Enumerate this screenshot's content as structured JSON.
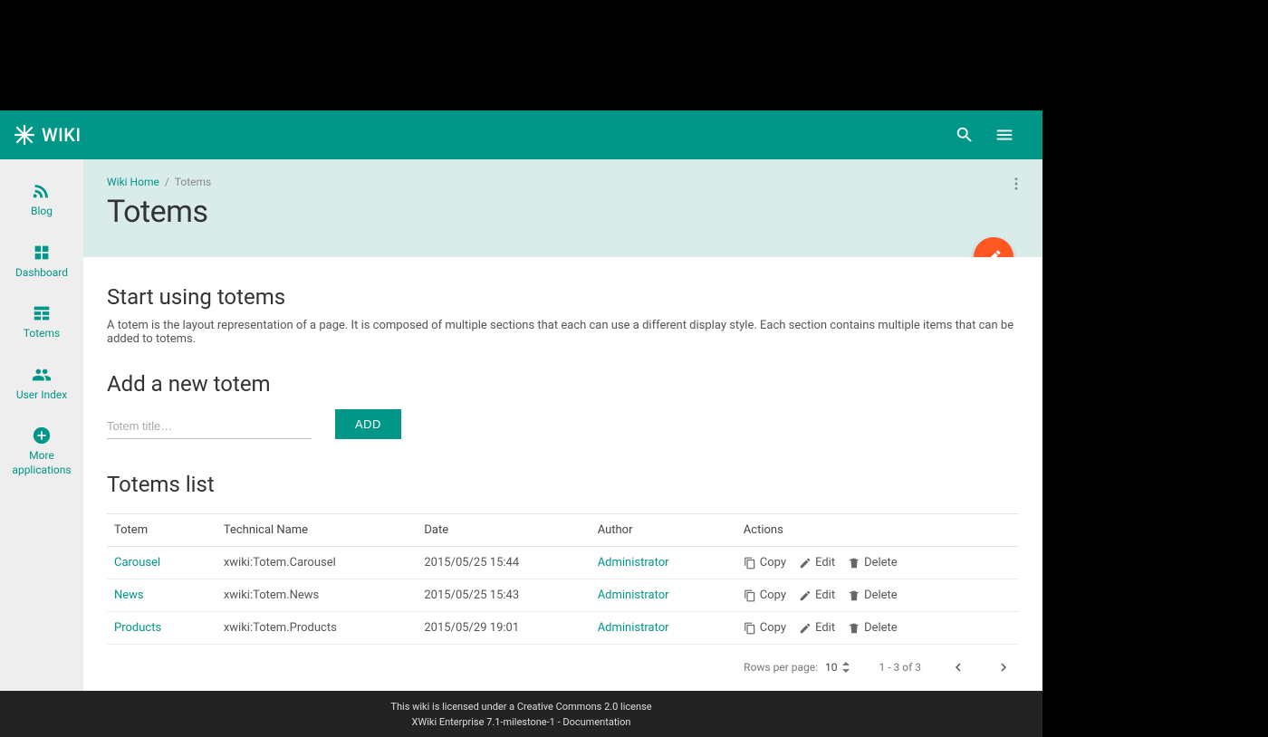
{
  "brand": {
    "text": "WIKI"
  },
  "breadcrumb": {
    "home": "Wiki Home",
    "current": "Totems"
  },
  "page": {
    "title": "Totems"
  },
  "intro": {
    "heading": "Start using totems",
    "body": "A totem is the layout representation of a page. It is composed of multiple sections that each can use a different display style. Each section contains multiple items that can be added to totems."
  },
  "add": {
    "heading": "Add a new totem",
    "placeholder": "Totem title…",
    "button": "ADD"
  },
  "list": {
    "heading": "Totems list",
    "columns": {
      "totem": "Totem",
      "tech": "Technical Name",
      "date": "Date",
      "author": "Author",
      "actions": "Actions"
    },
    "rows": [
      {
        "name": "Carousel",
        "tech": "xwiki:Totem.Carousel",
        "date": "2015/05/25 15:44",
        "author": "Administrator"
      },
      {
        "name": "News",
        "tech": "xwiki:Totem.News",
        "date": "2015/05/25 15:43",
        "author": "Administrator"
      },
      {
        "name": "Products",
        "tech": "xwiki:Totem.Products",
        "date": "2015/05/29 19:01",
        "author": "Administrator"
      }
    ],
    "actions": {
      "copy": "Copy",
      "edit": "Edit",
      "delete": "Delete"
    },
    "pager": {
      "rows_label": "Rows per page:",
      "rows_value": "10",
      "range": "1 - 3 of 3"
    }
  },
  "sidebar": {
    "items": [
      {
        "label": "Blog"
      },
      {
        "label": "Dashboard"
      },
      {
        "label": "Totems"
      },
      {
        "label": "User Index"
      },
      {
        "label": "More applications"
      }
    ]
  },
  "footer": {
    "line1": "This wiki is licensed under a Creative Commons 2.0 license",
    "line2": "XWiki Enterprise 7.1-milestone-1 - Documentation"
  }
}
